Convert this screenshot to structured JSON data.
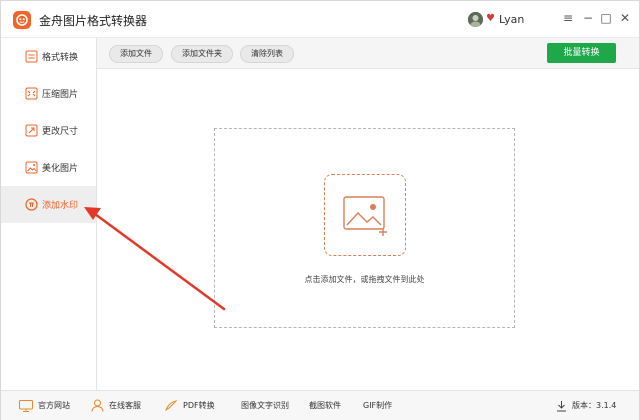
{
  "app": {
    "title": "金舟图片格式转换器"
  },
  "user": {
    "name": "Lyan"
  },
  "window_controls": {
    "menu": "≡",
    "minimize": "−",
    "maximize": "□",
    "close": "✕"
  },
  "sidebar": {
    "items": [
      {
        "label": "格式转换",
        "icon": "format-convert-icon"
      },
      {
        "label": "压缩图片",
        "icon": "compress-image-icon"
      },
      {
        "label": "更改尺寸",
        "icon": "resize-icon"
      },
      {
        "label": "美化图片",
        "icon": "beautify-image-icon"
      },
      {
        "label": "添加水印",
        "icon": "watermark-icon",
        "active": true
      }
    ]
  },
  "toolbar": {
    "add_file": "添加文件",
    "add_folder": "添加文件夹",
    "clear_list": "清除列表",
    "batch_convert": "批量转换"
  },
  "dropzone": {
    "hint": "点击添加文件，或拖拽文件到此处"
  },
  "footer": {
    "items": [
      {
        "label": "官方网站",
        "icon": "monitor-icon"
      },
      {
        "label": "在线客服",
        "icon": "user-service-icon"
      },
      {
        "label": "PDF转换",
        "icon": "pdf-icon"
      },
      {
        "label": "图像文字识别",
        "icon": ""
      },
      {
        "label": "截图软件",
        "icon": ""
      },
      {
        "label": "GIF制作",
        "icon": ""
      }
    ],
    "version_label": "版本：",
    "version_value": "3.1.4"
  },
  "colors": {
    "accent": "#f0642a",
    "primary_button": "#1fa84a",
    "annotation_arrow": "#e23a2a"
  }
}
